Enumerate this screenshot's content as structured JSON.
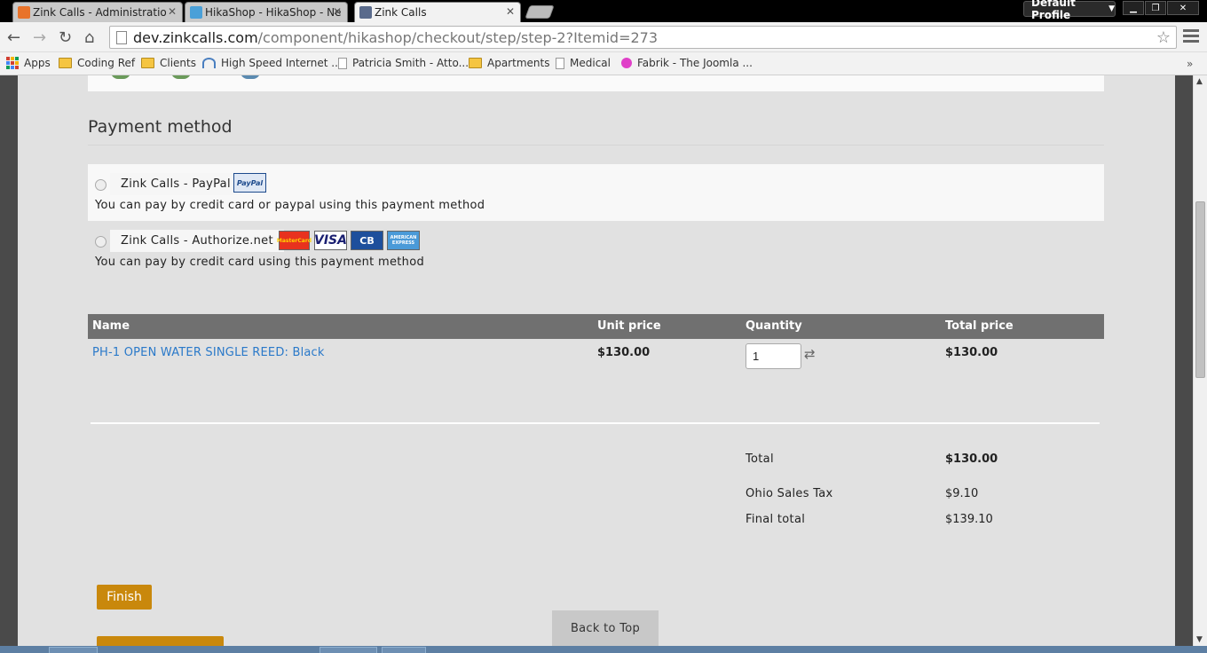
{
  "browser": {
    "tabs": [
      {
        "title": "Zink Calls - Administratio",
        "active": false
      },
      {
        "title": "HikaShop - HikaShop - Ne",
        "active": false
      },
      {
        "title": "Zink Calls",
        "active": true
      }
    ],
    "profile_label": "Default Profile",
    "url_host": "dev.zinkcalls.com",
    "url_path": "/component/hikashop/checkout/step/step-2?Itemid=273",
    "bookmarks": [
      "Apps",
      "Coding Ref",
      "Clients",
      "High Speed Internet ...",
      "Patricia Smith - Atto...",
      "Apartments",
      "Medical",
      "Fabrik - The Joomla ..."
    ],
    "bookmarks_more": "»"
  },
  "payment": {
    "title": "Payment method",
    "methods": [
      {
        "name": "Zink Calls - PayPal",
        "description": "You can pay by credit card or paypal using this payment method",
        "logos": [
          "PayPal"
        ]
      },
      {
        "name": "Zink Calls - Authorize.net",
        "description": "You can pay by credit card using this payment method",
        "logos": [
          "MasterCard",
          "VISA",
          "CB",
          "AMERICAN EXPRESS"
        ]
      }
    ]
  },
  "cart": {
    "headers": {
      "name": "Name",
      "unit_price": "Unit price",
      "quantity": "Quantity",
      "total_price": "Total price"
    },
    "items": [
      {
        "name": "PH-1 OPEN WATER SINGLE REED: Black",
        "unit_price": "$130.00",
        "quantity": "1",
        "total_price": "$130.00"
      }
    ],
    "totals": [
      {
        "label": "Total",
        "value": "$130.00"
      },
      {
        "label": "Ohio Sales Tax",
        "value": "$9.10"
      },
      {
        "label": "Final total",
        "value": "$139.10"
      }
    ]
  },
  "actions": {
    "finish_label": "Finish",
    "back_to_top_label": "Back to Top"
  },
  "colors": {
    "accent_button": "#c9880c",
    "link": "#2a79c9",
    "table_header": "#707070"
  }
}
